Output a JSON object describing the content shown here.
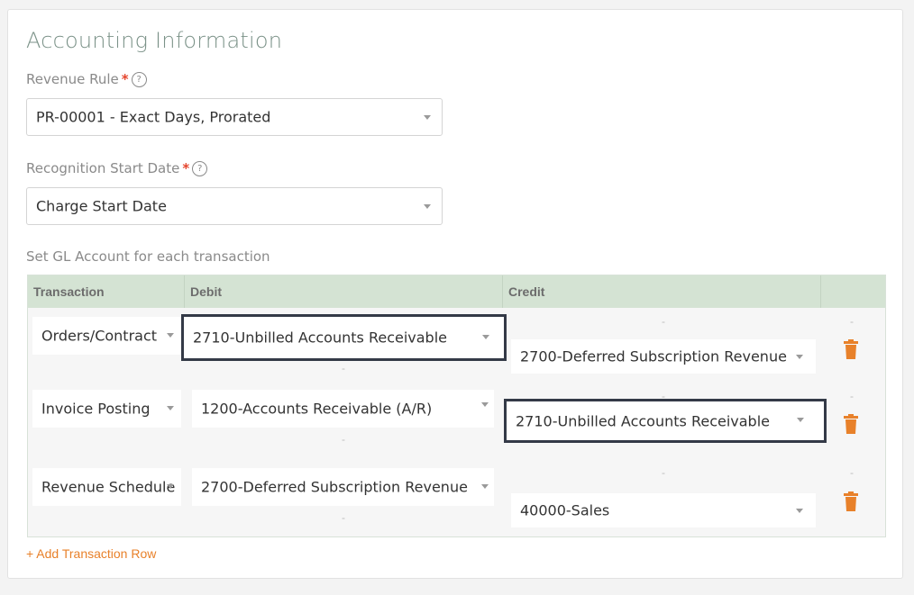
{
  "title": "Accounting Information",
  "revenue_rule": {
    "label": "Revenue Rule",
    "required": "*",
    "help": "?",
    "value": "PR-00001 - Exact Days, Prorated"
  },
  "recognition_start": {
    "label": "Recognition Start Date",
    "required": "*",
    "help": "?",
    "value": "Charge Start Date"
  },
  "gl_label": "Set GL Account for each transaction",
  "table": {
    "headers": [
      "Transaction",
      "Debit",
      "Credit",
      ""
    ],
    "rows": [
      {
        "transaction": "Orders/Contract",
        "debit": "2710-Unbilled Accounts Receivable",
        "credit": "2700-Deferred Subscription Revenue"
      },
      {
        "transaction": "Invoice Posting",
        "debit": "1200-Accounts Receivable (A/R)",
        "credit": "2710-Unbilled Accounts Receivable"
      },
      {
        "transaction": "Revenue Schedule",
        "debit": "2700-Deferred Subscription Revenue",
        "credit": "40000-Sales"
      }
    ],
    "placeholder": "-"
  },
  "add_row": "+ Add Transaction Row",
  "colors": {
    "title": "#7b9288",
    "header_bg": "#d4e3d3",
    "accent": "#e8812a",
    "required": "#e5452d",
    "highlight": "#343a47"
  }
}
